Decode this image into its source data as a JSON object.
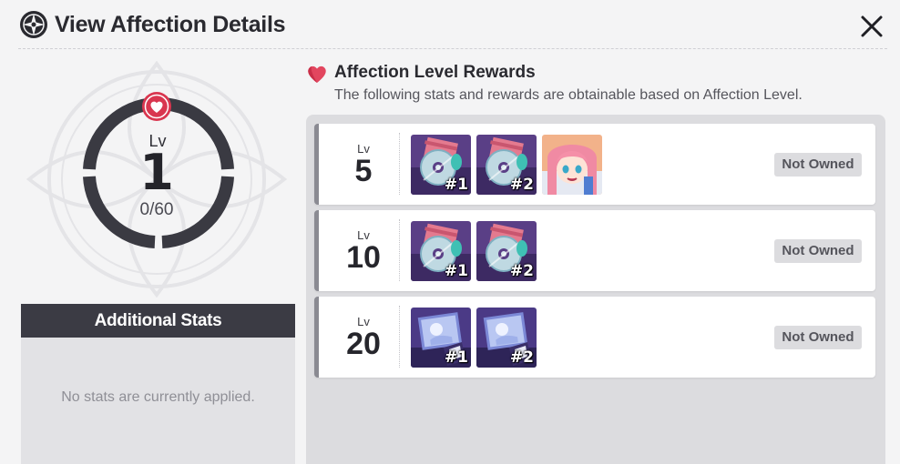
{
  "header": {
    "title": "View Affection Details",
    "title_icon": "compass-star-icon",
    "close_icon": "close-icon"
  },
  "affection": {
    "level_label": "Lv",
    "level": "1",
    "progress_text": "0/60",
    "progress": 0,
    "accent_color": "#d9364f"
  },
  "stats": {
    "title": "Additional Stats",
    "empty_text": "No stats are currently applied."
  },
  "rewards": {
    "title": "Affection Level Rewards",
    "subtitle": "The following stats and rewards are obtainable based on Affection Level.",
    "rows": [
      {
        "lv_label": "Lv",
        "lv": "5",
        "status": "Not Owned",
        "items": [
          {
            "kind": "disc",
            "tag": "#1"
          },
          {
            "kind": "disc",
            "tag": "#2"
          },
          {
            "kind": "portrait",
            "tag": ""
          }
        ]
      },
      {
        "lv_label": "Lv",
        "lv": "10",
        "status": "Not Owned",
        "items": [
          {
            "kind": "disc",
            "tag": "#1"
          },
          {
            "kind": "disc",
            "tag": "#2"
          }
        ]
      },
      {
        "lv_label": "Lv",
        "lv": "20",
        "status": "Not Owned",
        "items": [
          {
            "kind": "card",
            "tag": "#1"
          },
          {
            "kind": "card",
            "tag": "#2"
          }
        ]
      }
    ]
  }
}
